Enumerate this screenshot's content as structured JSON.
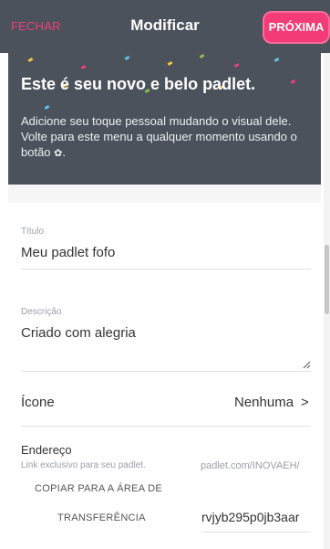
{
  "header": {
    "close_label": "FECHAR",
    "title": "Modificar",
    "next_label": "PRÓXIMA"
  },
  "hero": {
    "heading": "Este é seu novo e belo padlet.",
    "body_prefix": "Adicione seu toque pessoal mudando o visual dele. Volte para este menu a qualquer momento usando o botão",
    "body_suffix": "."
  },
  "form": {
    "title_label": "Título",
    "title_value": "Meu padlet fofo",
    "description_label": "Descrição",
    "description_value": "Criado com alegria",
    "icon_label": "Ícone",
    "icon_value": "Nenhuma",
    "address_label": "Endereço",
    "address_hint": "Link exclusivo para seu padlet.",
    "address_prefix": "padlet.com/INOVAEH/",
    "copy_label_line1": "COPIAR PARA A ÁREA DE",
    "copy_label_line2": "TRANSFERÊNCIA",
    "address_slug": "rvjyb295p0jb3aar"
  },
  "icons": {
    "gear": "gear-icon",
    "chevron": "chevron-right-icon",
    "resize": "resize-handle-icon"
  },
  "colors": {
    "accent": "#f23b77",
    "header_bg": "#4b525c"
  }
}
